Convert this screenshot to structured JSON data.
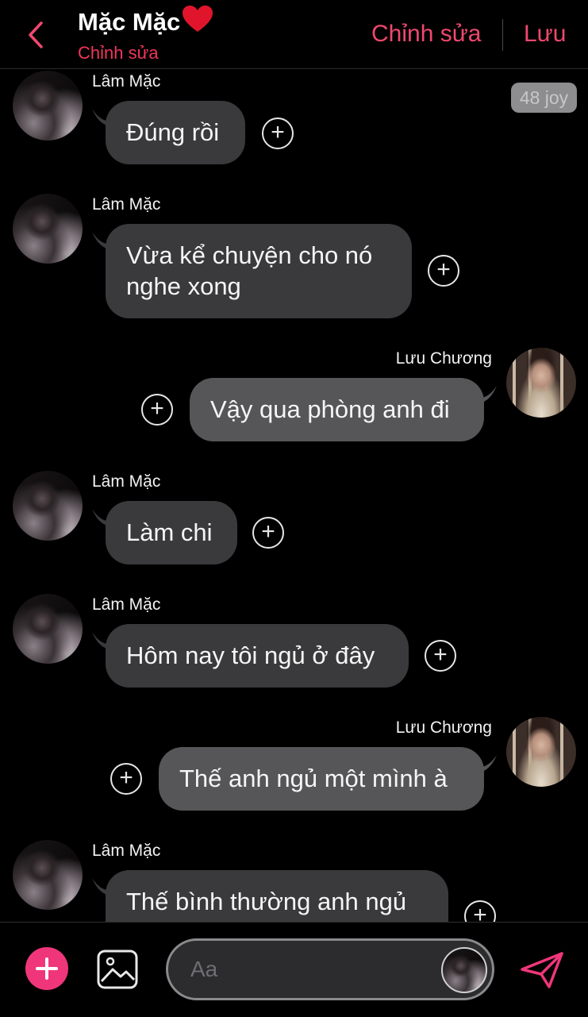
{
  "header": {
    "title": "Mặc Mặc",
    "heart_icon": "heart-icon",
    "subtitle": "Chỉnh sửa",
    "edit_label": "Chỉnh sửa",
    "save_label": "Lưu"
  },
  "badge": {
    "text": "48 joy"
  },
  "messages": [
    {
      "sender": "Lâm Mặc",
      "side": "left",
      "text": "Đúng rồi"
    },
    {
      "sender": "Lâm Mặc",
      "side": "left",
      "line1": "Vừa kể chuyện cho nó",
      "line2": "nghe xong"
    },
    {
      "sender": "Lưu Chương",
      "side": "right",
      "text": "Vậy qua phòng anh đi"
    },
    {
      "sender": "Lâm Mặc",
      "side": "left",
      "text": "Làm chi"
    },
    {
      "sender": "Lâm Mặc",
      "side": "left",
      "text": "Hôm nay tôi ngủ ở đây"
    },
    {
      "sender": "Lưu Chương",
      "side": "right",
      "text": "Thế anh ngủ một mình à"
    },
    {
      "sender": "Lâm Mặc",
      "side": "left",
      "text": "Thế bình thường anh ngủ"
    }
  ],
  "composer": {
    "placeholder": "Aa"
  },
  "colors": {
    "accent": "#f0486e",
    "bubble_received": "#3a3a3c",
    "bubble_sent": "#565658",
    "background": "#000000"
  }
}
